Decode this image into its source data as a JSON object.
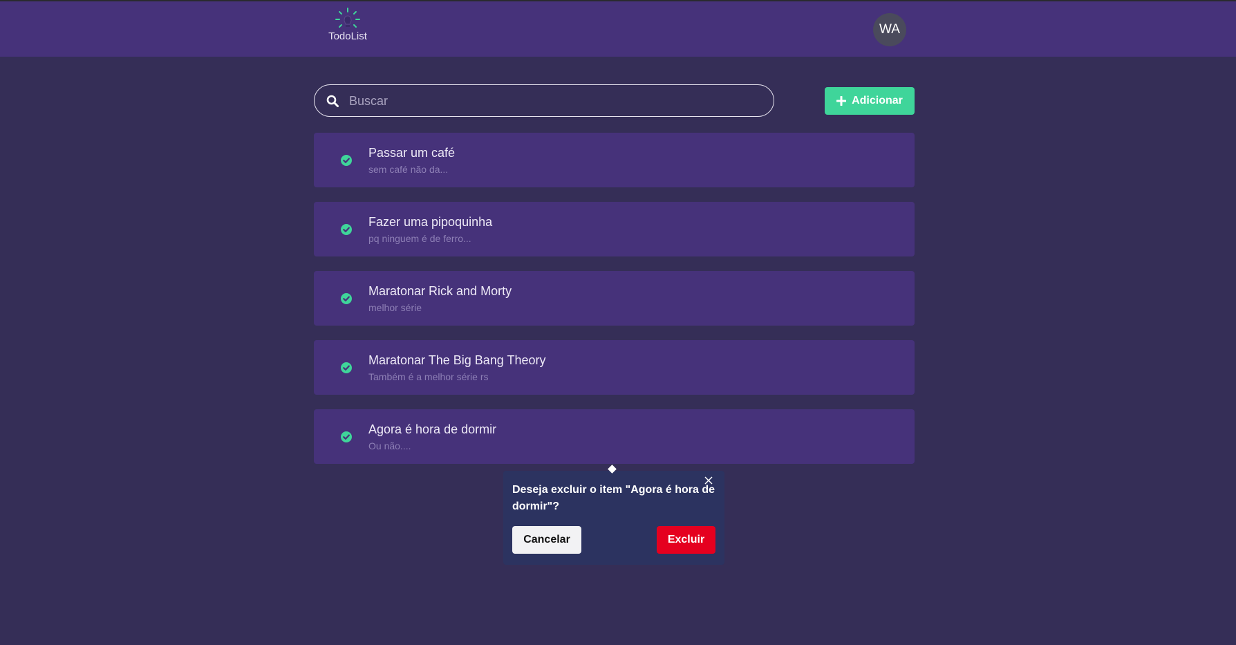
{
  "header": {
    "logo_text": "TodoList",
    "avatar_initials": "WA"
  },
  "search": {
    "placeholder": "Buscar",
    "value": ""
  },
  "toolbar": {
    "add_label": "Adicionar"
  },
  "tasks": [
    {
      "title": "Passar um café",
      "description": "sem café não da...",
      "done": true
    },
    {
      "title": "Fazer uma pipoquinha",
      "description": "pq ninguem é de ferro...",
      "done": true
    },
    {
      "title": "Maratonar Rick and Morty",
      "description": "melhor série",
      "done": true
    },
    {
      "title": "Maratonar The Big Bang Theory",
      "description": "Também é a melhor série rs",
      "done": true
    },
    {
      "title": "Agora é hora de dormir",
      "description": "Ou não....",
      "done": true
    }
  ],
  "confirm_popover": {
    "message": "Deseja excluir o item \"Agora é hora de dormir\"?",
    "cancel_label": "Cancelar",
    "delete_label": "Excluir"
  },
  "colors": {
    "background": "#352e57",
    "header": "#46327a",
    "card": "#46327a",
    "accent_green": "#3fd59a",
    "danger_red": "#e5001f",
    "popover": "#2c3360"
  },
  "icons": {
    "logo": "lightbulb-icon",
    "search": "search-icon",
    "add": "plus-icon",
    "done": "check-circle-icon",
    "close": "close-icon"
  }
}
